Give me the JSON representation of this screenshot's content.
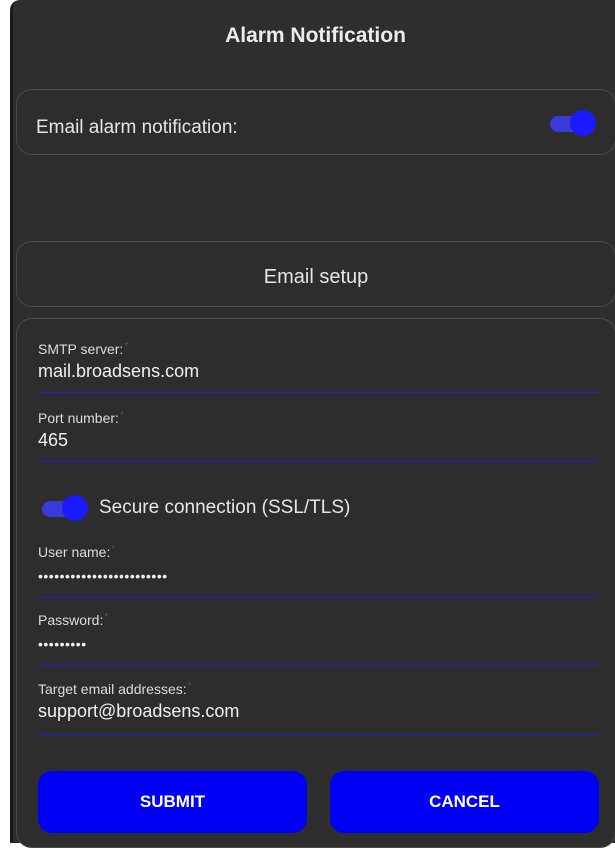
{
  "header": {
    "title": "Alarm Notification"
  },
  "email_notification": {
    "label": "Email alarm notification:",
    "enabled": true
  },
  "setup": {
    "title": "Email setup"
  },
  "form": {
    "smtp": {
      "label": "SMTP server:",
      "value": "mail.broadsens.com"
    },
    "port": {
      "label": "Port number:",
      "value": "465"
    },
    "ssl": {
      "label": "Secure connection (SSL/TLS)",
      "enabled": true
    },
    "user": {
      "label": "User name:",
      "value": "••••••••••••••••••••••••"
    },
    "password": {
      "label": "Password:",
      "value": "•••••••••"
    },
    "target": {
      "label": "Target email addresses:",
      "value": "support@broadsens.com"
    },
    "required_mark": "*"
  },
  "buttons": {
    "submit": "SUBMIT",
    "cancel": "CANCEL"
  },
  "colors": {
    "accent": "#0000f5",
    "toggle_track": "#3a3ad8",
    "toggle_knob": "#1a1aff",
    "underline": "#1f1fd0",
    "panel": "#2e2e2e"
  }
}
